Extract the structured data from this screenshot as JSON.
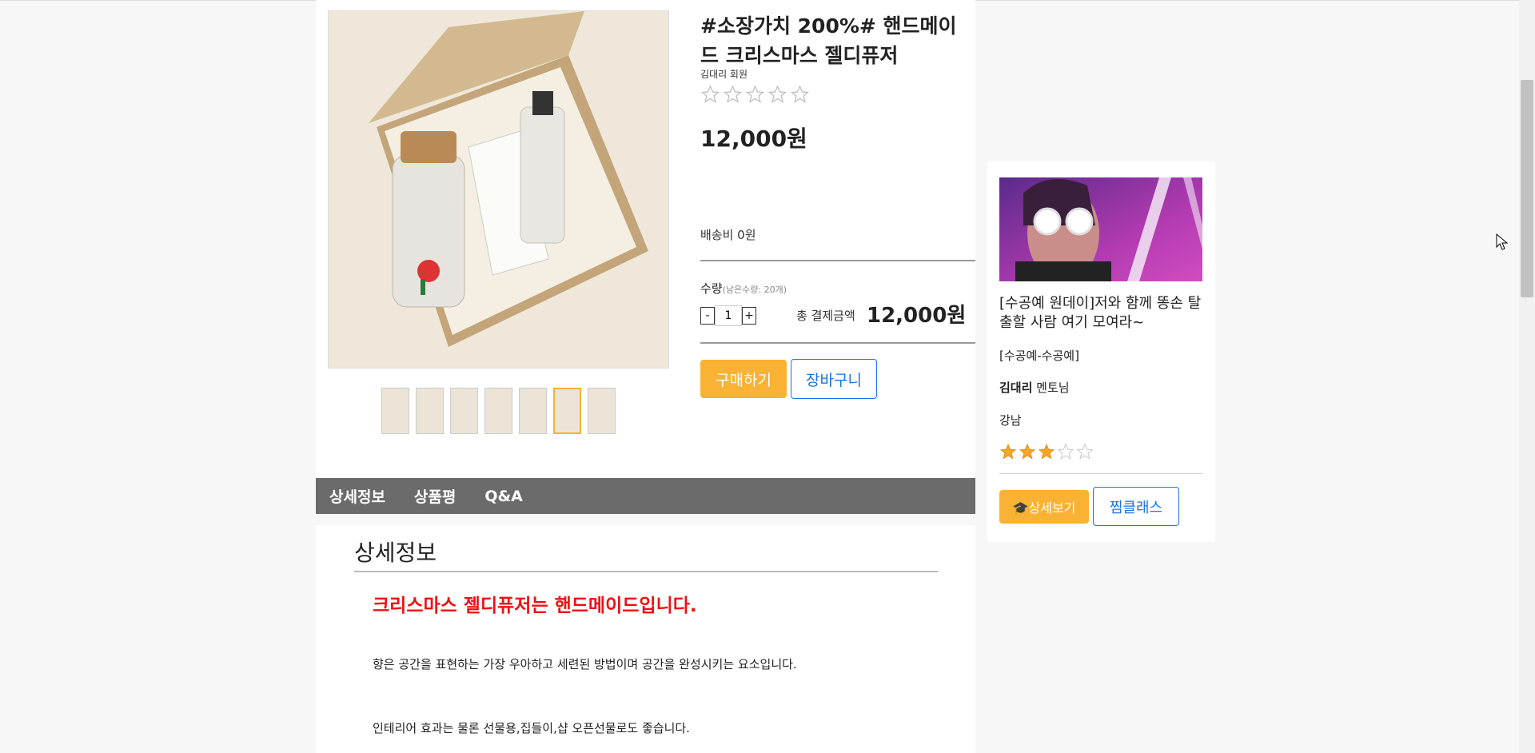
{
  "product": {
    "title": "#소장가치 200%# 핸드메이드 크리스마스 젤디퓨저",
    "author": "김대리 회원",
    "rating": 0,
    "rating_max": 5,
    "price": "12,000원",
    "shipping": "배송비 0원",
    "qty_label": "수량",
    "qty_remaining": "(남은수량: 20개)",
    "qty_minus": "-",
    "qty_value": "1",
    "qty_plus": "+",
    "total_label": "총 결제금액",
    "total_value": "12,000원",
    "buy_label": "구매하기",
    "cart_label": "장바구니",
    "thumbnail_count": 7,
    "active_thumbnail": 5
  },
  "tabs": [
    "상세정보",
    "상품평",
    "Q&A"
  ],
  "detail": {
    "heading": "상세정보",
    "highlight": "크리스마스 젤디퓨저는 핸드메이드입니다.",
    "paragraphs": [
      "향은 공간을 표현하는 가장 우아하고 세련된 방법이며 공간을 완성시키는 요소입니다.",
      "인테리어 효과는 물론 선물용,집들이,샵 오픈선물로도 좋습니다."
    ]
  },
  "class_card": {
    "title": "[수공예 원데이]저와 함께 똥손 탈출할 사람 여기 모여라~",
    "category": "[수공예-수공예]",
    "mentor_name": "김대리",
    "mentor_suffix": " 멘토님",
    "location": "강남",
    "rating": 3,
    "rating_max": 5,
    "detail_button": "상세보기",
    "wish_button": "찜클래스"
  },
  "colors": {
    "accent": "#f9b233",
    "link_blue": "#1a73e8",
    "highlight_red": "#ee1111",
    "tabbar_bg": "#6b6b6b"
  },
  "icons": {
    "graduation": "graduation-cap-icon",
    "star_filled": "star-filled-icon",
    "star_empty": "star-empty-icon"
  }
}
